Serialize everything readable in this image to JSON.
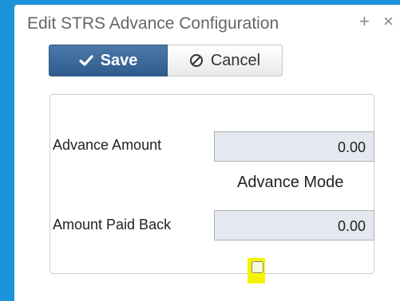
{
  "dialog": {
    "title": "Edit STRS Advance Configuration",
    "maximize_glyph": "+",
    "close_glyph": "×"
  },
  "toolbar": {
    "save_label": "Save",
    "save_icon": "checkmark-icon",
    "cancel_label": "Cancel",
    "cancel_icon": "ban-icon"
  },
  "form": {
    "advance_amount_label": "Advance Amount",
    "advance_amount_value": "0.00",
    "advance_mode_label": "Advance Mode",
    "advance_mode_checked": false,
    "amount_paid_back_label": "Amount Paid Back",
    "amount_paid_back_value": "0.00"
  },
  "colors": {
    "background": "#1b93d8",
    "save_button": "#3a6899",
    "highlight": "#f4f400"
  }
}
